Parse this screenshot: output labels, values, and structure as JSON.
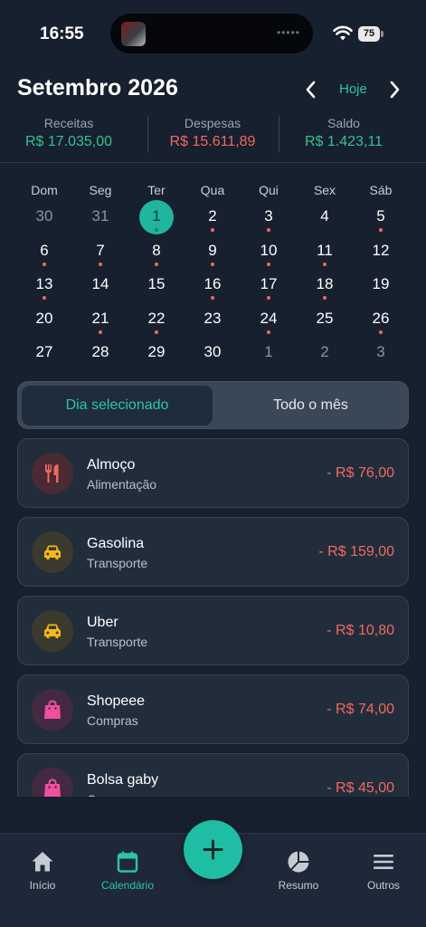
{
  "status_bar": {
    "time": "16:55",
    "battery": "75"
  },
  "header": {
    "month_title": "Setembro 2026",
    "today_label": "Hoje"
  },
  "summary": {
    "income": {
      "label": "Receitas",
      "value": "R$ 17.035,00"
    },
    "expenses": {
      "label": "Despesas",
      "value": "R$ 15.611,89"
    },
    "balance": {
      "label": "Saldo",
      "value": "R$ 1.423,11"
    }
  },
  "calendar": {
    "weekdays": [
      "Dom",
      "Seg",
      "Ter",
      "Qua",
      "Qui",
      "Sex",
      "Sáb"
    ],
    "weeks": [
      [
        {
          "d": "30",
          "m": true,
          "dot": false
        },
        {
          "d": "31",
          "m": true,
          "dot": false
        },
        {
          "d": "1",
          "m": false,
          "dot": true,
          "sel": true
        },
        {
          "d": "2",
          "m": false,
          "dot": true
        },
        {
          "d": "3",
          "m": false,
          "dot": true
        },
        {
          "d": "4",
          "m": false,
          "dot": false
        },
        {
          "d": "5",
          "m": false,
          "dot": true
        }
      ],
      [
        {
          "d": "6",
          "m": false,
          "dot": true
        },
        {
          "d": "7",
          "m": false,
          "dot": true
        },
        {
          "d": "8",
          "m": false,
          "dot": true
        },
        {
          "d": "9",
          "m": false,
          "dot": true
        },
        {
          "d": "10",
          "m": false,
          "dot": true
        },
        {
          "d": "11",
          "m": false,
          "dot": true
        },
        {
          "d": "12",
          "m": false,
          "dot": false
        }
      ],
      [
        {
          "d": "13",
          "m": false,
          "dot": true
        },
        {
          "d": "14",
          "m": false,
          "dot": false
        },
        {
          "d": "15",
          "m": false,
          "dot": false
        },
        {
          "d": "16",
          "m": false,
          "dot": true
        },
        {
          "d": "17",
          "m": false,
          "dot": true
        },
        {
          "d": "18",
          "m": false,
          "dot": true
        },
        {
          "d": "19",
          "m": false,
          "dot": false
        }
      ],
      [
        {
          "d": "20",
          "m": false,
          "dot": false
        },
        {
          "d": "21",
          "m": false,
          "dot": true
        },
        {
          "d": "22",
          "m": false,
          "dot": true
        },
        {
          "d": "23",
          "m": false,
          "dot": false
        },
        {
          "d": "24",
          "m": false,
          "dot": true
        },
        {
          "d": "25",
          "m": false,
          "dot": false
        },
        {
          "d": "26",
          "m": false,
          "dot": true
        }
      ],
      [
        {
          "d": "27",
          "m": false,
          "dot": false
        },
        {
          "d": "28",
          "m": false,
          "dot": false
        },
        {
          "d": "29",
          "m": false,
          "dot": false
        },
        {
          "d": "30",
          "m": false,
          "dot": false
        },
        {
          "d": "1",
          "m": true,
          "dot": false
        },
        {
          "d": "2",
          "m": true,
          "dot": false
        },
        {
          "d": "3",
          "m": true,
          "dot": false
        }
      ]
    ]
  },
  "segmented": {
    "selected_day": "Dia selecionado",
    "whole_month": "Todo o mês"
  },
  "transactions": [
    {
      "title": "Almoço",
      "category": "Alimentação",
      "amount": "- R$ 76,00",
      "icon": "fork-knife-icon",
      "icon_color": "#f2685e",
      "icon_bg": "#4a2a33"
    },
    {
      "title": "Gasolina",
      "category": "Transporte",
      "amount": "- R$ 159,00",
      "icon": "car-icon",
      "icon_color": "#f5b91b",
      "icon_bg": "#3b3a2e"
    },
    {
      "title": "Uber",
      "category": "Transporte",
      "amount": "- R$ 10,80",
      "icon": "car-icon",
      "icon_color": "#f5b91b",
      "icon_bg": "#3b3a2e"
    },
    {
      "title": "Shopeee",
      "category": "Compras",
      "amount": "- R$ 74,00",
      "icon": "shopping-bag-icon",
      "icon_color": "#ee4fa0",
      "icon_bg": "#432a42"
    },
    {
      "title": "Bolsa gaby",
      "category": "Compras",
      "amount": "- R$ 45,00",
      "icon": "shopping-bag-icon",
      "icon_color": "#ee4fa0",
      "icon_bg": "#432a42"
    }
  ],
  "tabbar": {
    "home": "Início",
    "calendar": "Calendário",
    "summary": "Resumo",
    "others": "Outros"
  },
  "colors": {
    "accent": "#2ec4a9",
    "income": "#34c38f",
    "expense": "#f2685e",
    "background": "#17202e"
  }
}
